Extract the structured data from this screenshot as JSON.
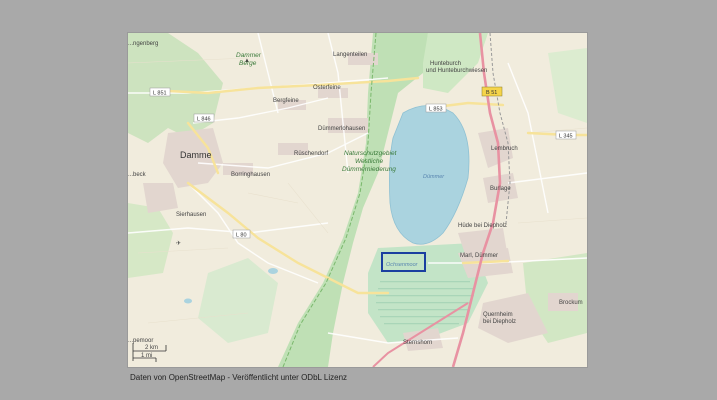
{
  "map": {
    "places": {
      "oldenberg": "...ngenberg",
      "dammer_berge_1": "Dammer",
      "dammer_berge_2": "Berge",
      "langenteilen": "Langenteilen",
      "hunteburch_1": "Hunteburch",
      "hunteburch_2": "und Hunteburchwiesen",
      "osterfeine": "Osterfeine",
      "bergfeine": "Bergfeine",
      "duemmerlohausen": "Dümmerlohausen",
      "damme": "Damme",
      "rueschendorf": "Rüschendorf",
      "borringhausen": "Borringhausen",
      "nsg_1": "Naturschutzgebiet",
      "nsg_2": "Westliche",
      "nsg_3": "Dümmerniederung",
      "duemmer_lake": "Dümmer",
      "lembruch": "Lembruch",
      "burlage": "Burlage",
      "sierhausen": "Sierhausen",
      "huede": "Hüde bei Diepholz",
      "ochsenmoor": "Ochsenmoor",
      "marl": "Marl, Dümmer",
      "brockum": "Brockum",
      "quernheim_1": "Quernheim",
      "quernheim_2": "bei Diepholz",
      "sternshorn": "Sternshorn",
      "beck": "...beck",
      "vorpemoor": "...pemoor"
    },
    "roads": {
      "l851": "L 851",
      "l846": "L 846",
      "l853": "L 853",
      "b51": "B 51",
      "l345": "L 345",
      "l80": "L 80"
    },
    "scale": {
      "km": "2 km",
      "mi": "1 mi"
    },
    "colors": {
      "land": "#f1ecdd",
      "water": "#aad3df",
      "forest": "#add19e",
      "wetland": "#c8e6c0",
      "highlight_box": "#1a3fa0"
    }
  },
  "caption": "Daten von OpenStreetMap - Veröffentlicht unter ODbL Lizenz"
}
